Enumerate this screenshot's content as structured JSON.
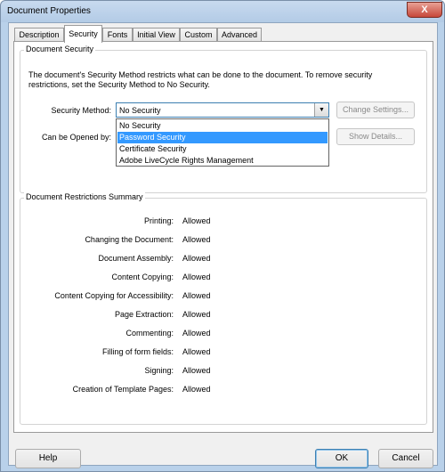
{
  "window": {
    "title": "Document Properties",
    "close": "X"
  },
  "tabs": [
    {
      "label": "Description"
    },
    {
      "label": "Security",
      "active": true
    },
    {
      "label": "Fonts"
    },
    {
      "label": "Initial View"
    },
    {
      "label": "Custom"
    },
    {
      "label": "Advanced"
    }
  ],
  "security": {
    "group_title": "Document Security",
    "description_line1": "The document's Security Method restricts what can be done to the document. To remove security",
    "description_line2": "restrictions, set the Security Method to No Security.",
    "method_label": "Security Method:",
    "method_value": "No Security",
    "opened_by_label": "Can be Opened by:",
    "change_settings": "Change Settings...",
    "show_details": "Show Details...",
    "dropdown_options": [
      {
        "label": "No Security",
        "selected": false
      },
      {
        "label": "Password Security",
        "selected": true
      },
      {
        "label": "Certificate Security",
        "selected": false
      },
      {
        "label": "Adobe LiveCycle Rights Management",
        "selected": false
      }
    ]
  },
  "restrictions": {
    "group_title": "Document Restrictions Summary",
    "rows": [
      {
        "label": "Printing:",
        "value": "Allowed"
      },
      {
        "label": "Changing the Document:",
        "value": "Allowed"
      },
      {
        "label": "Document Assembly:",
        "value": "Allowed"
      },
      {
        "label": "Content Copying:",
        "value": "Allowed"
      },
      {
        "label": "Content Copying for Accessibility:",
        "value": "Allowed"
      },
      {
        "label": "Page Extraction:",
        "value": "Allowed"
      },
      {
        "label": "Commenting:",
        "value": "Allowed"
      },
      {
        "label": "Filling of form fields:",
        "value": "Allowed"
      },
      {
        "label": "Signing:",
        "value": "Allowed"
      },
      {
        "label": "Creation of Template Pages:",
        "value": "Allowed"
      }
    ]
  },
  "footer": {
    "help": "Help",
    "ok": "OK",
    "cancel": "Cancel"
  }
}
